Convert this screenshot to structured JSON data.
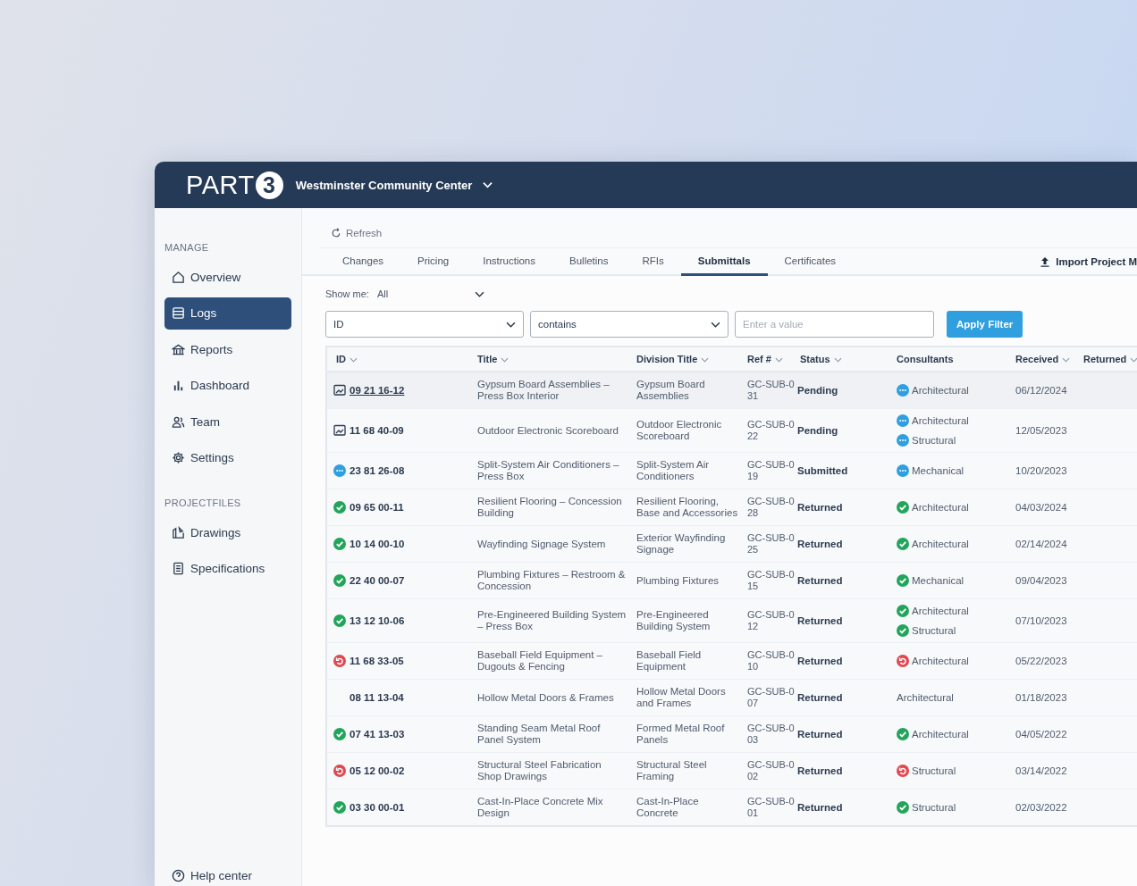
{
  "header": {
    "logo_text": "PART",
    "logo_digit": "3",
    "project": "Westminster Community Center"
  },
  "sidebar": {
    "sections": [
      {
        "label": "MANAGE",
        "items": [
          {
            "label": "Overview",
            "kind": "home",
            "selected": false
          },
          {
            "label": "Logs",
            "kind": "list",
            "selected": true
          },
          {
            "label": "Reports",
            "kind": "bank",
            "selected": false
          },
          {
            "label": "Dashboard",
            "kind": "bars",
            "selected": false
          },
          {
            "label": "Team",
            "kind": "people",
            "selected": false
          },
          {
            "label": "Settings",
            "kind": "gear",
            "selected": false
          }
        ]
      },
      {
        "label": "PROJECTFILES",
        "items": [
          {
            "label": "Drawings",
            "kind": "drawing",
            "selected": false
          },
          {
            "label": "Specifications",
            "kind": "doc",
            "selected": false
          }
        ]
      }
    ],
    "help": "Help center"
  },
  "toolbar": {
    "refresh": "Refresh"
  },
  "tabs": [
    {
      "label": "Changes",
      "selected": false
    },
    {
      "label": "Pricing",
      "selected": false
    },
    {
      "label": "Instructions",
      "selected": false
    },
    {
      "label": "Bulletins",
      "selected": false
    },
    {
      "label": "RFIs",
      "selected": false
    },
    {
      "label": "Submittals",
      "selected": true
    },
    {
      "label": "Certificates",
      "selected": false
    }
  ],
  "import_button": "Import Project M",
  "filter": {
    "show_me_label": "Show me:",
    "show_me_value": "All",
    "field": "ID",
    "operator": "contains",
    "value_placeholder": "Enter a value",
    "apply": "Apply Filter"
  },
  "table": {
    "columns": [
      {
        "label": "ID",
        "sortable": true
      },
      {
        "label": "Title",
        "sortable": true
      },
      {
        "label": "Division Title",
        "sortable": true
      },
      {
        "label": "Ref #",
        "sortable": true
      },
      {
        "label": "Status",
        "sortable": true
      },
      {
        "label": "Consultants",
        "sortable": false
      },
      {
        "label": "Received",
        "sortable": true
      },
      {
        "label": "Returned",
        "sortable": true
      }
    ],
    "rows": [
      {
        "id": "09 21 16-12",
        "kind": "document",
        "title": "Gypsum Board Assemblies – Press Box Interior",
        "division": "Gypsum Board Assemblies",
        "ref": "GC-SUB-031",
        "status": "Pending",
        "consultants": [
          {
            "name": "Architectural",
            "kind": "pending"
          }
        ],
        "received": "06/12/2024",
        "selected": true
      },
      {
        "id": "11 68 40-09",
        "kind": "document",
        "title": "Outdoor Electronic Scoreboard",
        "division": "Outdoor Electronic Scoreboard",
        "ref": "GC-SUB-022",
        "status": "Pending",
        "consultants": [
          {
            "name": "Architectural",
            "kind": "pending"
          },
          {
            "name": "Structural",
            "kind": "pending"
          }
        ],
        "received": "12/05/2023",
        "selected": false
      },
      {
        "id": "23 81 26-08",
        "kind": "pending",
        "title": "Split-System Air Conditioners – Press Box",
        "division": "Split-System Air Conditioners",
        "ref": "GC-SUB-019",
        "status": "Submitted",
        "consultants": [
          {
            "name": "Mechanical",
            "kind": "pending"
          }
        ],
        "received": "10/20/2023",
        "selected": false
      },
      {
        "id": "09 65 00-11",
        "kind": "approved",
        "title": "Resilient Flooring – Concession Building",
        "division": "Resilient Flooring, Base and Accessories",
        "ref": "GC-SUB-028",
        "status": "Returned",
        "consultants": [
          {
            "name": "Architectural",
            "kind": "approved"
          }
        ],
        "received": "04/03/2024",
        "selected": false
      },
      {
        "id": "10 14 00-10",
        "kind": "approved",
        "title": "Wayfinding Signage System",
        "division": "Exterior Wayfinding Signage",
        "ref": "GC-SUB-025",
        "status": "Returned",
        "consultants": [
          {
            "name": "Architectural",
            "kind": "approved"
          }
        ],
        "received": "02/14/2024",
        "selected": false
      },
      {
        "id": "22 40 00-07",
        "kind": "approved",
        "title": "Plumbing Fixtures – Restroom & Concession",
        "division": "Plumbing Fixtures",
        "ref": "GC-SUB-015",
        "status": "Returned",
        "consultants": [
          {
            "name": "Mechanical",
            "kind": "approved"
          }
        ],
        "received": "09/04/2023",
        "selected": false
      },
      {
        "id": "13 12 10-06",
        "kind": "approved",
        "title": "Pre-Engineered Building System – Press Box",
        "division": "Pre-Engineered Building System",
        "ref": "GC-SUB-012",
        "status": "Returned",
        "consultants": [
          {
            "name": "Architectural",
            "kind": "approved"
          },
          {
            "name": "Structural",
            "kind": "approved"
          }
        ],
        "received": "07/10/2023",
        "selected": false
      },
      {
        "id": "11 68 33-05",
        "kind": "rejected",
        "title": "Baseball Field Equipment – Dugouts & Fencing",
        "division": "Baseball Field Equipment",
        "ref": "GC-SUB-010",
        "status": "Returned",
        "consultants": [
          {
            "name": "Architectural",
            "kind": "rejected"
          }
        ],
        "received": "05/22/2023",
        "selected": false
      },
      {
        "id": "08 11 13-04",
        "kind": "plain",
        "title": "Hollow Metal Doors & Frames",
        "division": "Hollow Metal Doors and Frames",
        "ref": "GC-SUB-007",
        "status": "Returned",
        "consultants": [
          {
            "name": "Architectural",
            "kind": "plain"
          }
        ],
        "received": "01/18/2023",
        "selected": false
      },
      {
        "id": "07 41 13-03",
        "kind": "approved",
        "title": "Standing Seam Metal Roof Panel System",
        "division": "Formed Metal Roof Panels",
        "ref": "GC-SUB-003",
        "status": "Returned",
        "consultants": [
          {
            "name": "Architectural",
            "kind": "approved"
          }
        ],
        "received": "04/05/2022",
        "selected": false
      },
      {
        "id": "05 12 00-02",
        "kind": "rejected",
        "title": "Structural Steel Fabrication Shop Drawings",
        "division": "Structural Steel Framing",
        "ref": "GC-SUB-002",
        "status": "Returned",
        "consultants": [
          {
            "name": "Structural",
            "kind": "rejected"
          }
        ],
        "received": "03/14/2022",
        "selected": false
      },
      {
        "id": "03 30 00-01",
        "kind": "approved",
        "title": "Cast-In-Place Concrete Mix Design",
        "division": "Cast-In-Place Concrete",
        "ref": "GC-SUB-001",
        "status": "Returned",
        "consultants": [
          {
            "name": "Structural",
            "kind": "approved"
          }
        ],
        "received": "02/03/2022",
        "selected": false
      }
    ]
  }
}
